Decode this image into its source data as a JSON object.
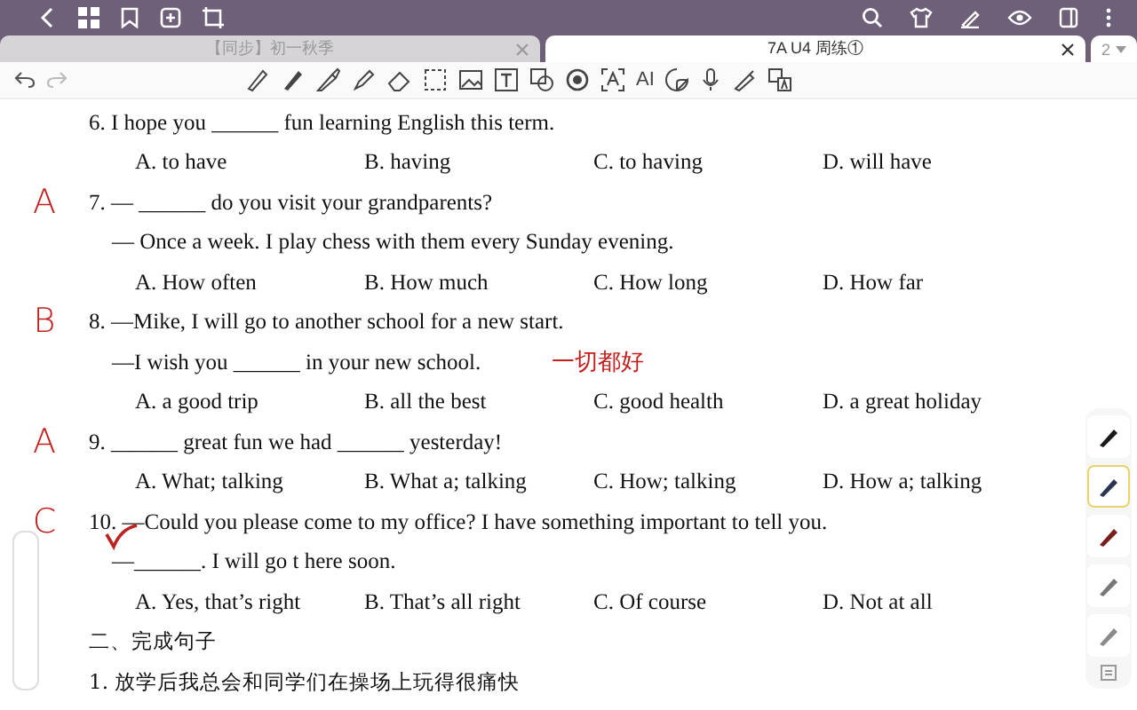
{
  "tabs": [
    {
      "label": "【同步】初一秋季",
      "selected": false
    },
    {
      "label": "7A U4 周练①",
      "selected": true
    }
  ],
  "tab_count": "2",
  "toolbar": {
    "ai_label": "AI"
  },
  "questions": [
    {
      "stem": "6. I hope you ______ fun learning English this term.",
      "options": [
        "A. to have",
        "B. having",
        "C. to having",
        "D. will have"
      ]
    },
    {
      "answer": "A",
      "stem": "7. — ______ do you visit your grandparents?",
      "follow": "— Once a week. I play chess with them every Sunday evening.",
      "options": [
        "A. How often",
        "B. How much",
        "C. How long",
        "D. How far"
      ]
    },
    {
      "answer": "B",
      "stem": "8. —Mike, I will go to another school for a new start.",
      "follow": "—I wish you ______ in your new school.",
      "note": "一切都好",
      "options": [
        "A. a good trip",
        "B. all the best",
        "C. good health",
        "D. a great holiday"
      ]
    },
    {
      "answer": "A",
      "stem": "9. ______ great fun we had ______ yesterday!",
      "options": [
        "A. What; talking",
        "B. What a; talking",
        "C. How; talking",
        "D. How a; talking"
      ]
    },
    {
      "answer": "C",
      "checked": true,
      "stem": "10. —Could you please come to my office? I have something important to tell you.",
      "follow": "—______. I will go t here soon.",
      "options": [
        "A. Yes, that’s right",
        "B. That’s all right",
        "C. Of course",
        "D. Not at all"
      ]
    }
  ],
  "section": {
    "heading": "二、完成句子",
    "items": [
      "1. 放学后我总会和同学们在操场上玩得很痛快"
    ]
  },
  "pens": [
    {
      "color": "#1a1a1a",
      "selected": false
    },
    {
      "color": "#2a3550",
      "selected": true
    },
    {
      "color": "#7a1c1c",
      "selected": false
    },
    {
      "color": "#777777",
      "selected": false
    },
    {
      "color": "#8a8a8a",
      "selected": false
    }
  ]
}
